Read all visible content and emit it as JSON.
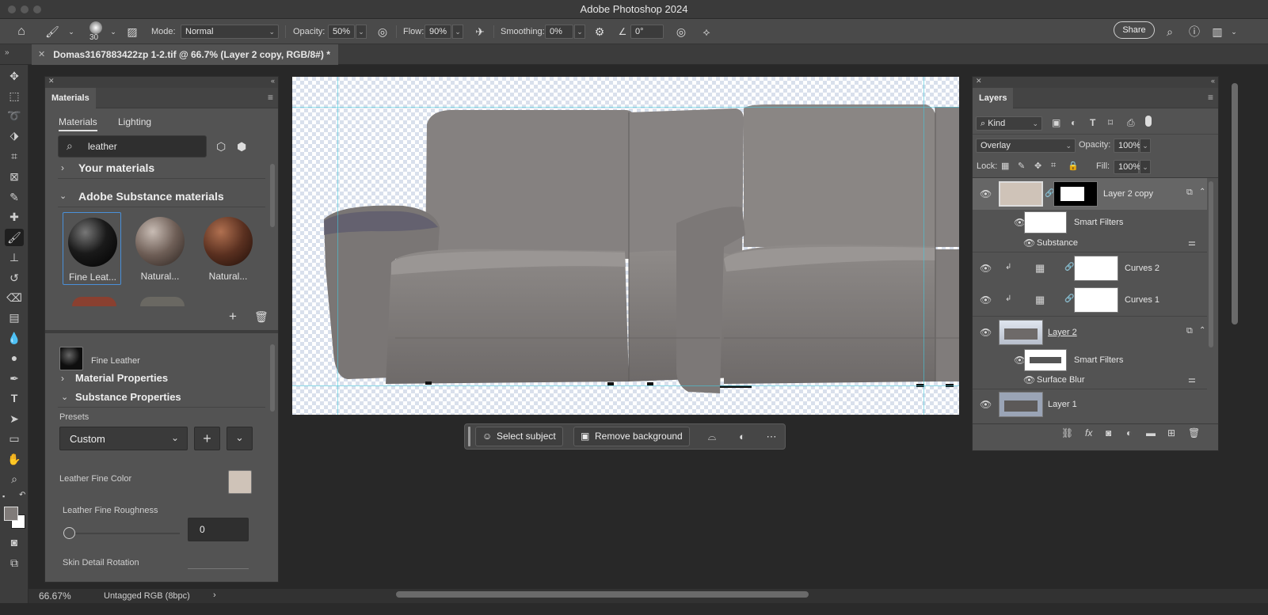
{
  "app": {
    "title": "Adobe Photoshop 2024"
  },
  "options_bar": {
    "brush_size": "30",
    "mode_label": "Mode:",
    "mode_value": "Normal",
    "opacity_label": "Opacity:",
    "opacity_value": "50%",
    "flow_label": "Flow:",
    "flow_value": "90%",
    "smoothing_label": "Smoothing:",
    "smoothing_value": "0%",
    "angle_value": "0°",
    "share_label": "Share"
  },
  "document": {
    "tab_title": "Domas3167883422zp 1-2.tif @ 66.7% (Layer 2 copy, RGB/8#) *"
  },
  "materials": {
    "panel_title": "Materials",
    "tabs": [
      "Materials",
      "Lighting"
    ],
    "search_value": "leather",
    "your_materials": "Your materials",
    "substance_materials": "Adobe Substance materials",
    "thumbs": [
      {
        "label": "Fine Leat...",
        "color": "#1a1a1a"
      },
      {
        "label": "Natural...",
        "color": "#6e5e56"
      },
      {
        "label": "Natural...",
        "color": "#5a3020"
      }
    ],
    "selected_name": "Fine Leather",
    "material_properties": "Material Properties",
    "substance_properties": "Substance Properties",
    "presets_label": "Presets",
    "preset_value": "Custom",
    "color_label": "Leather Fine Color",
    "color_value": "#cfc3b8",
    "roughness_label": "Leather Fine Roughness",
    "roughness_value": "0",
    "rotation_label": "Skin Detail Rotation"
  },
  "context_bar": {
    "select_subject": "Select subject",
    "remove_background": "Remove background"
  },
  "layers": {
    "panel_title": "Layers",
    "kind_label": "Kind",
    "blend_mode": "Overlay",
    "opacity_label": "Opacity:",
    "opacity_value": "100%",
    "lock_label": "Lock:",
    "fill_label": "Fill:",
    "fill_value": "100%",
    "items": [
      {
        "name": "Layer 2 copy"
      },
      {
        "name": "Smart Filters"
      },
      {
        "name": "Substance"
      },
      {
        "name": "Curves 2"
      },
      {
        "name": "Curves 1"
      },
      {
        "name": "Layer 2"
      },
      {
        "name": "Smart Filters"
      },
      {
        "name": "Surface Blur"
      },
      {
        "name": "Layer 1"
      }
    ]
  },
  "status": {
    "zoom": "66.67%",
    "profile": "Untagged RGB (8bpc)"
  },
  "colors": {
    "accent": "#4a90d9",
    "sofa": "#807b79"
  }
}
